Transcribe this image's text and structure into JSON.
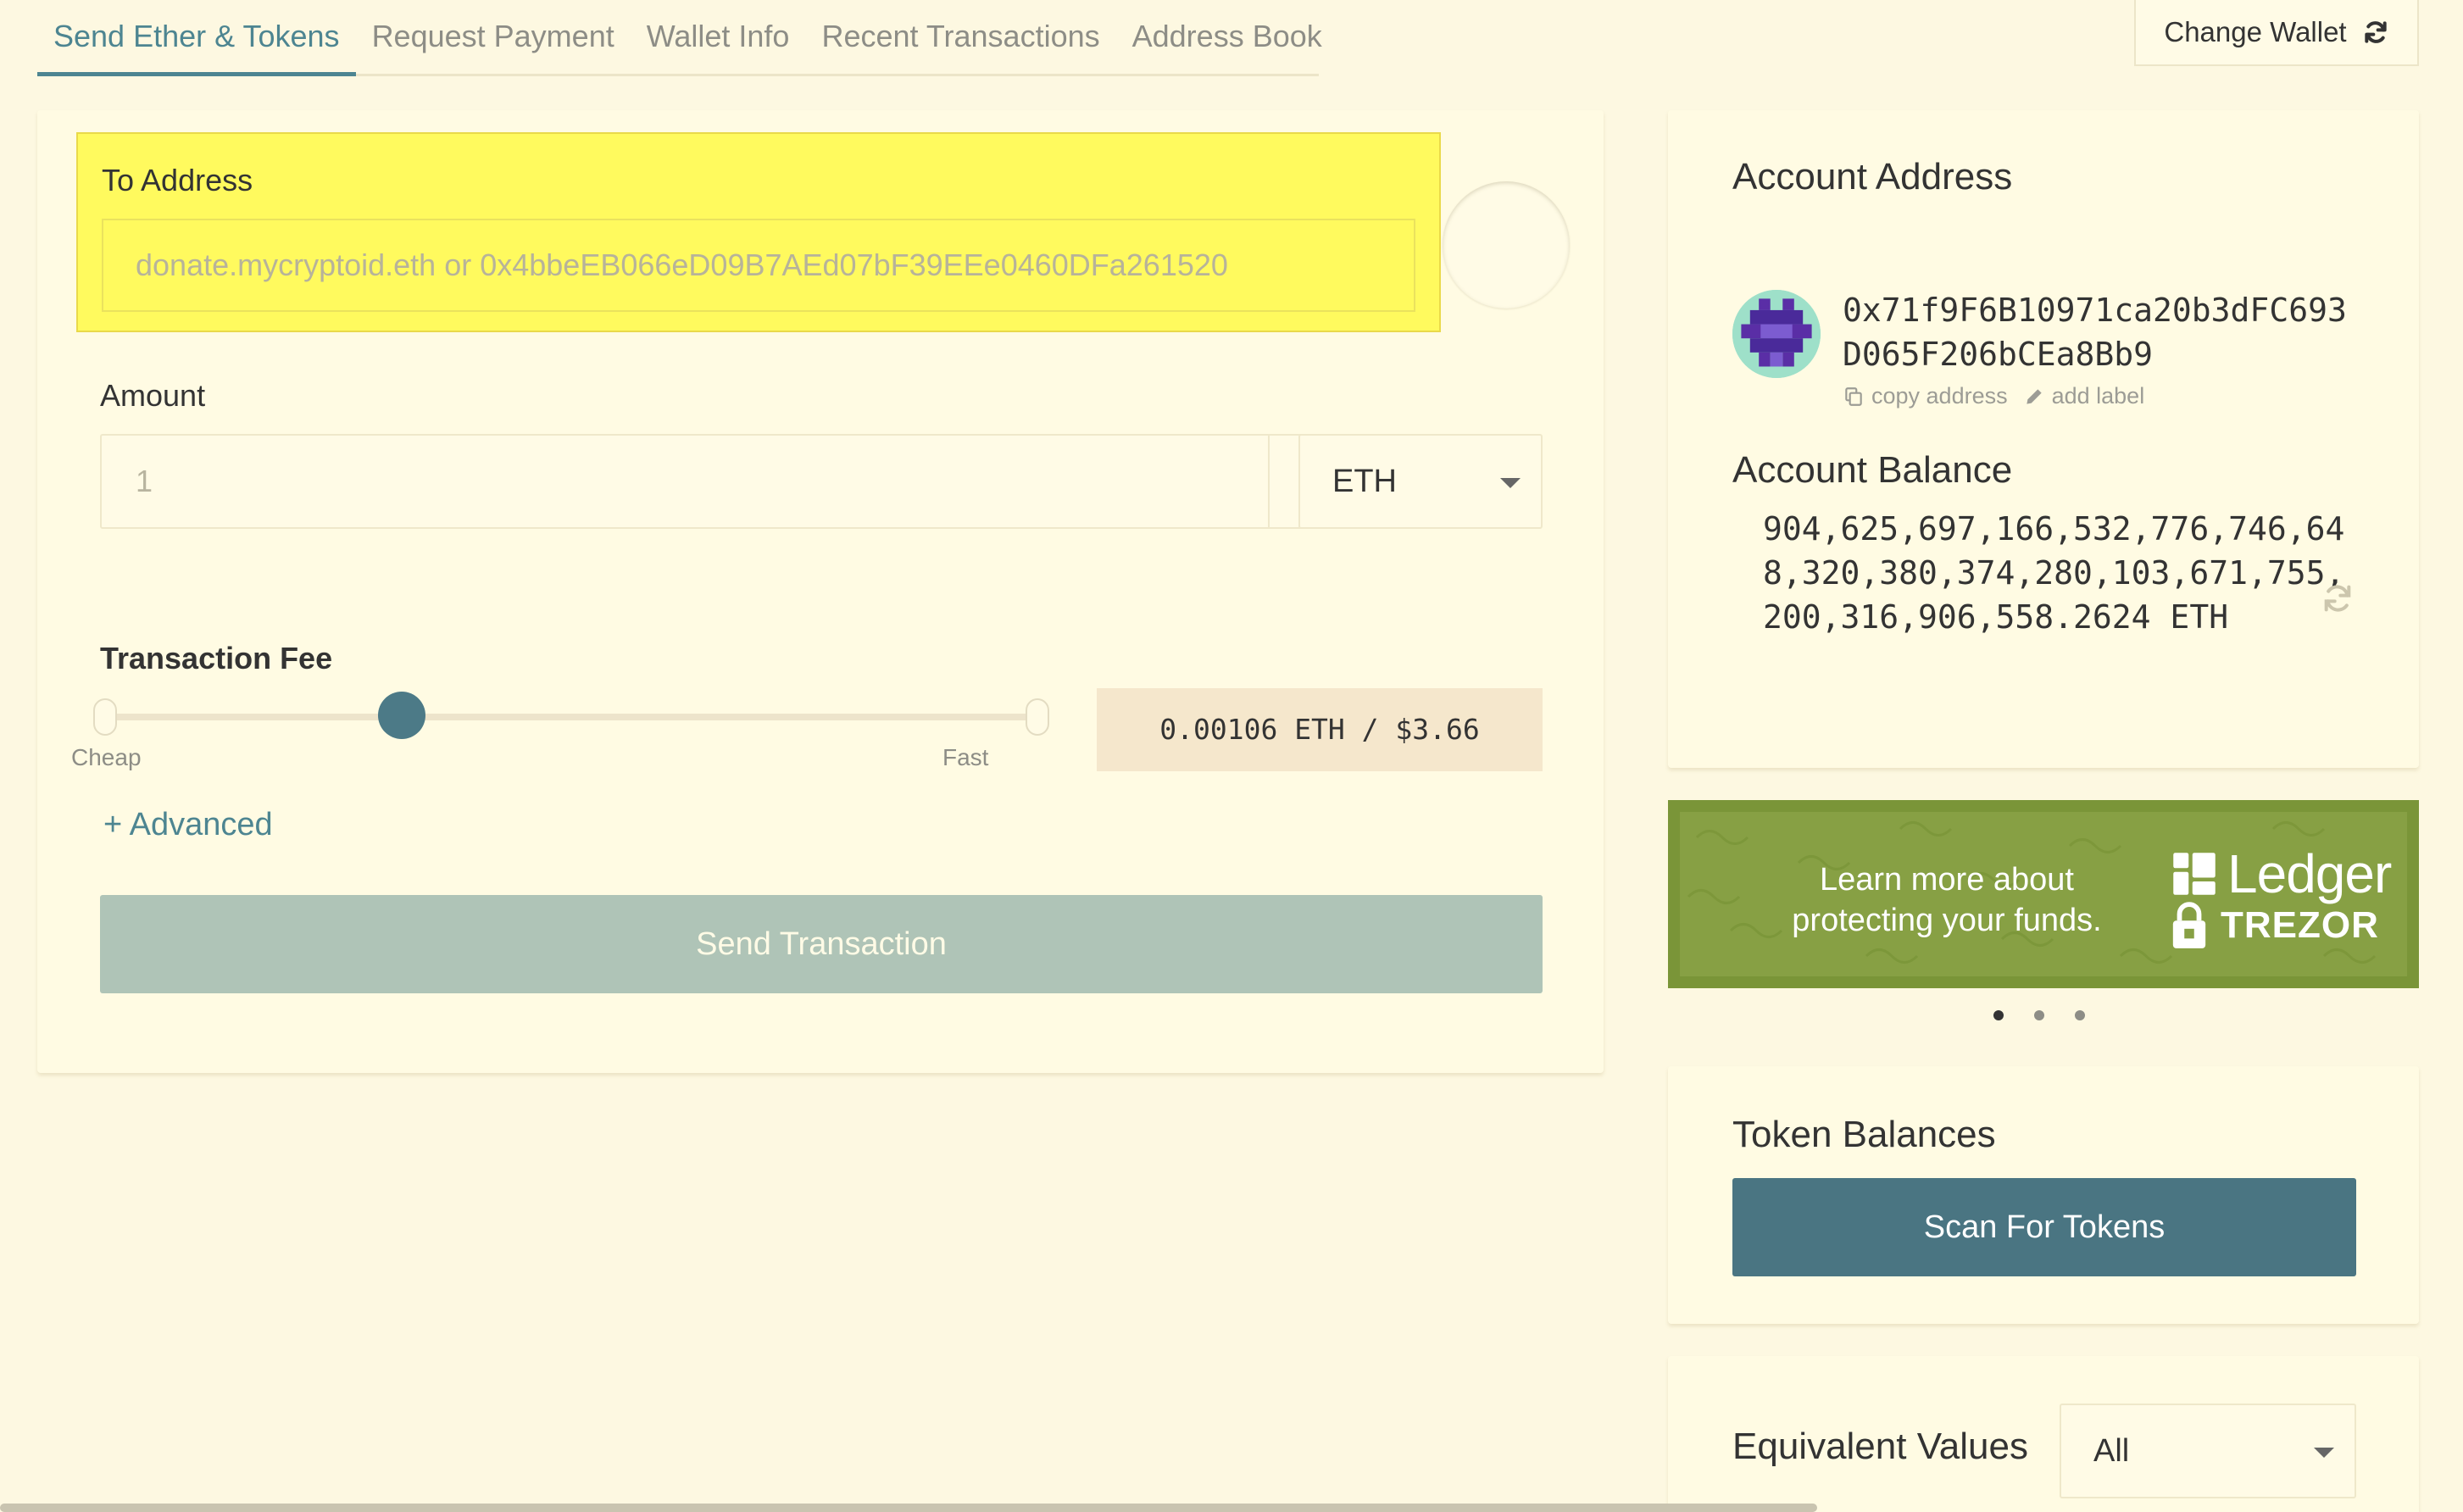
{
  "tabs": [
    {
      "label": "Send Ether & Tokens",
      "active": true
    },
    {
      "label": "Request Payment"
    },
    {
      "label": "Wallet Info"
    },
    {
      "label": "Recent Transactions"
    },
    {
      "label": "Address Book"
    }
  ],
  "header": {
    "change_wallet_label": "Change Wallet",
    "icon": "refresh-icon"
  },
  "send_form": {
    "to_address_label": "To Address",
    "to_address_placeholder": "donate.mycryptoid.eth or 0x4bbeEB066eD09B7AEd07bF39EEe0460DFa261520",
    "amount_label": "Amount",
    "amount_value": "1",
    "unit": "ETH",
    "fee_label": "Transaction Fee",
    "fee_slider": {
      "min_label": "Cheap",
      "max_label": "Fast",
      "position_fraction": 0.32
    },
    "fee_readout": "0.00106 ETH / $3.66",
    "advanced_label": "+ Advanced",
    "send_button": "Send Transaction"
  },
  "account": {
    "address_title": "Account Address",
    "address": "0x71f9F6B10971ca20b3dFC693D065F206bCEa8Bb9",
    "copy_label": "copy address",
    "add_label": "add label",
    "balance_title": "Account Balance",
    "balance": "904,625,697,166,532,776,746,648,320,380,374,280,103,671,755,200,316,906,558.2624 ETH"
  },
  "promo": {
    "line1": "Learn more about",
    "line2": "protecting your funds.",
    "brand1": "Ledger",
    "brand2": "TREZOR",
    "dots": 3,
    "active_dot": 0
  },
  "tokens": {
    "title": "Token Balances",
    "scan_button": "Scan For Tokens"
  },
  "equivalent": {
    "title": "Equivalent Values",
    "selected": "All"
  },
  "colors": {
    "background": "#fdf8e1",
    "accent": "#4d8591",
    "highlight": "#fffa5e",
    "promo_green": "#87a044"
  }
}
